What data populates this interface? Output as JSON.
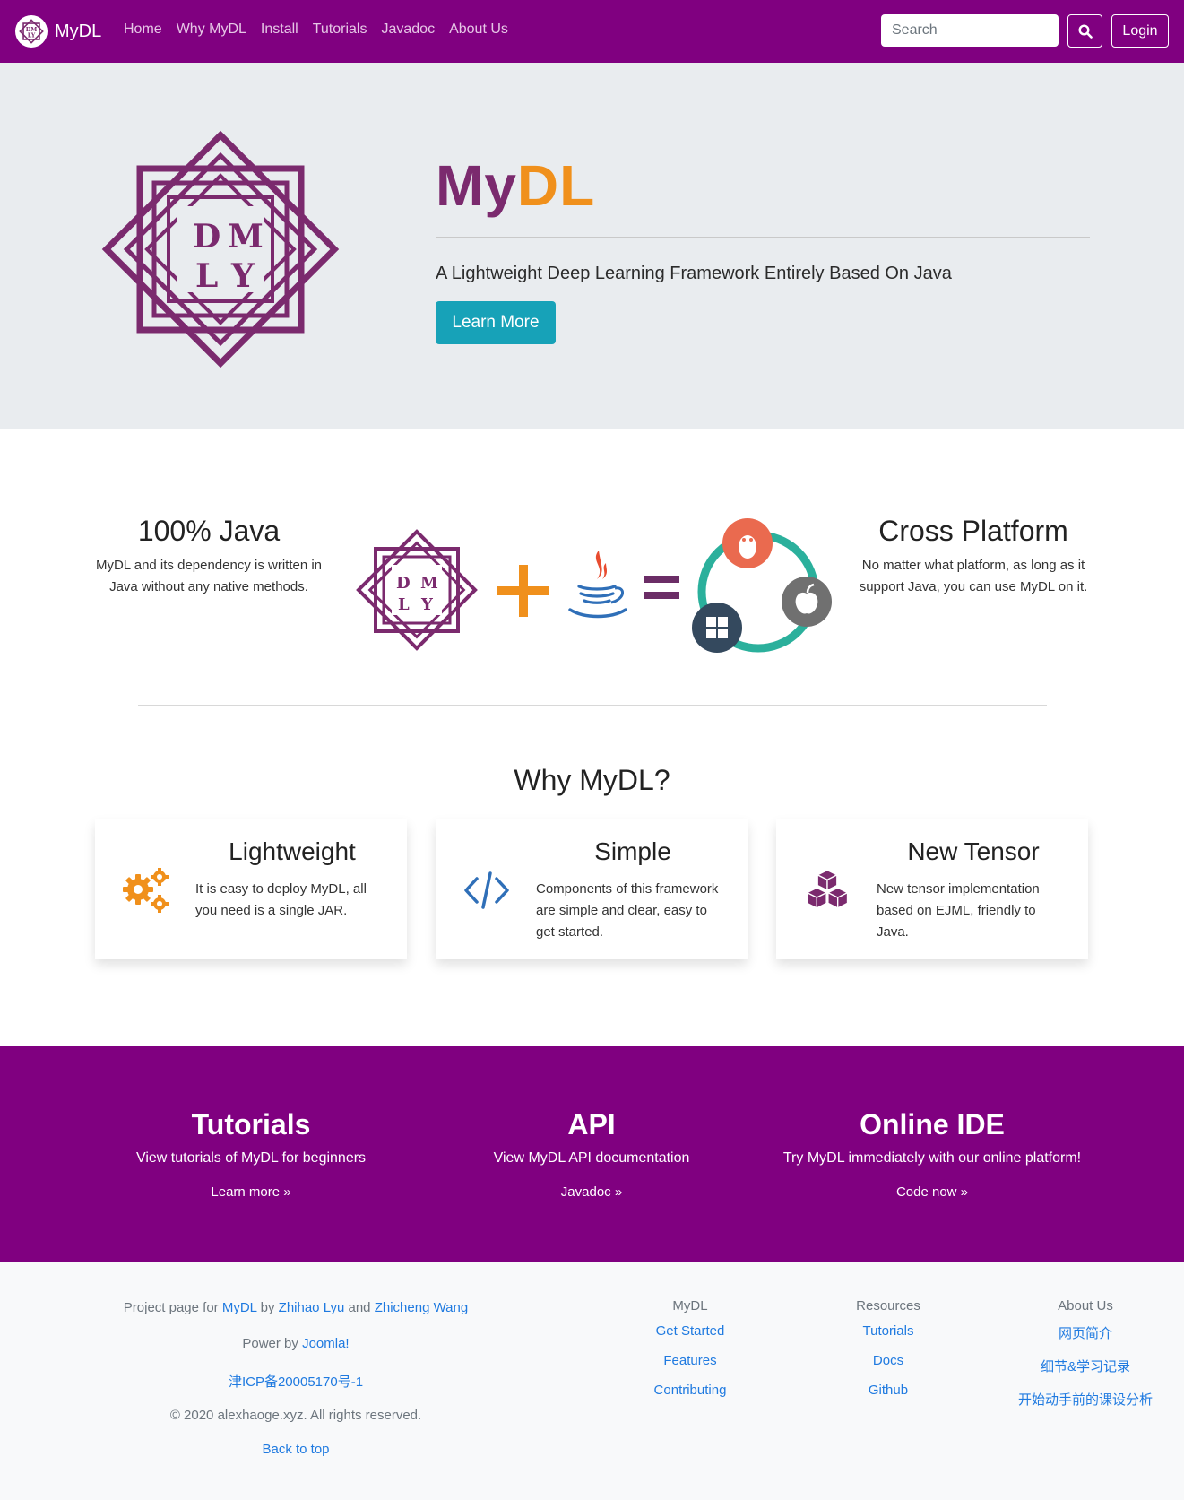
{
  "nav": {
    "brand": "MyDL",
    "logo_letters": [
      "D",
      "M",
      "L",
      "Y"
    ],
    "links": [
      "Home",
      "Why MyDL",
      "Install",
      "Tutorials",
      "Javadoc",
      "About Us"
    ],
    "search_placeholder": "Search",
    "login_label": "Login"
  },
  "hero": {
    "title_part1": "My",
    "title_part2": "DL",
    "subtitle": "A Lightweight Deep Learning Framework Entirely Based On Java",
    "button_label": "Learn More"
  },
  "features": {
    "left_title": "100% Java",
    "left_text": "MyDL and its dependency is written in Java without any native methods.",
    "right_title": "Cross Platform",
    "right_text": "No matter what platform, as long as it support Java, you can use MyDL on it."
  },
  "why": {
    "heading": "Why MyDL?",
    "cards": [
      {
        "title": "Lightweight",
        "text": "It is easy to deploy MyDL, all you need is a single JAR.",
        "icon": "gears-icon"
      },
      {
        "title": "Simple",
        "text": "Components of this framework are simple and clear, easy to get started.",
        "icon": "code-icon"
      },
      {
        "title": "New Tensor",
        "text": "New tensor implementation based on EJML, friendly to Java.",
        "icon": "cubes-icon"
      }
    ]
  },
  "band": [
    {
      "title": "Tutorials",
      "text": "View tutorials of MyDL for beginners",
      "link": "Learn more »"
    },
    {
      "title": "API",
      "text": "View MyDL API documentation",
      "link": "Javadoc »"
    },
    {
      "title": "Online IDE",
      "text": "Try MyDL immediately with our online platform!",
      "link": "Code now »"
    }
  ],
  "footer": {
    "project_prefix": "Project page for",
    "project_link": "MyDL",
    "by": "by",
    "author1": "Zhihao Lyu",
    "and": "and",
    "author2": "Zhicheng Wang",
    "power_prefix": "Power by",
    "power_link": "Joomla!",
    "icp": "津ICP备20005170号-1",
    "copyright": "© 2020 alexhaoge.xyz. All rights reserved.",
    "back_to_top": "Back to top",
    "columns": [
      {
        "heading": "MyDL",
        "links": [
          "Get Started",
          "Features",
          "Contributing"
        ]
      },
      {
        "heading": "Resources",
        "links": [
          "Tutorials",
          "Docs",
          "Github"
        ]
      },
      {
        "heading": "About Us",
        "links": [
          "网页简介",
          "细节&学习记录",
          "开始动手前的课设分析"
        ]
      }
    ]
  },
  "colors": {
    "brand_purple": "#800080",
    "logo_purple": "#7b2a6e",
    "accent_orange": "#f0901c",
    "button_teal": "#17a2b8",
    "link_blue": "#1f7ae0"
  }
}
